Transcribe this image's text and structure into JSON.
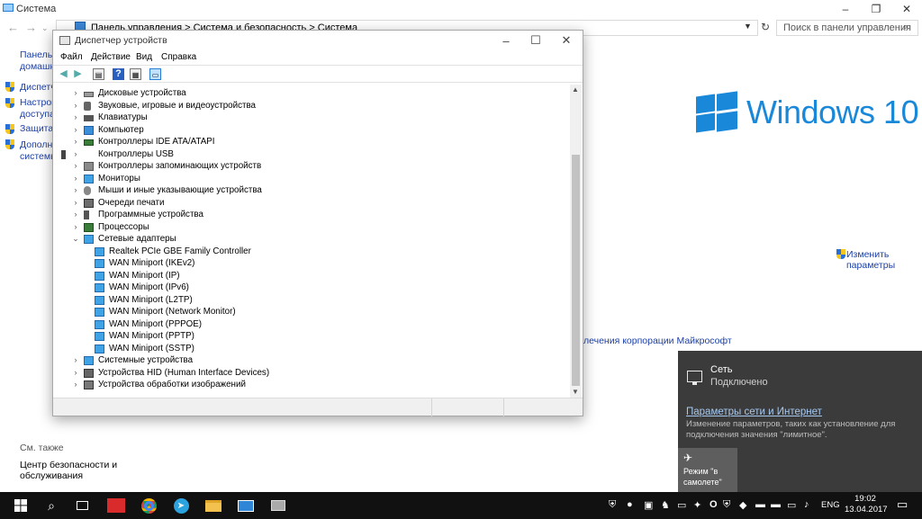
{
  "system_window": {
    "title": "Система",
    "address": "Панель управления  >  Система и безопасность  >  Система",
    "search_placeholder": "Поиск в панели управления",
    "left_nav": [
      {
        "label": "Панель у",
        "label2": "домашн"
      },
      {
        "label": "Диспетч"
      },
      {
        "label": "Настрой",
        "label2": "доступа"
      },
      {
        "label": "Защита с"
      },
      {
        "label": "Дополни",
        "label2": "системы"
      }
    ],
    "windows_brand": "Windows 10",
    "change_params_line1": "Изменить",
    "change_params_line2": "параметры",
    "ms_link": "лечения корпорации Майкрософт",
    "see_also": "См. также",
    "security_center_line1": "Центр безопасности и",
    "security_center_line2": "обслуживания"
  },
  "device_manager": {
    "title": "Диспетчер устройств",
    "menu": [
      "Файл",
      "Действие",
      "Вид",
      "Справка"
    ],
    "tree": [
      {
        "label": "Дисковые устройства",
        "icon": "disk-icon",
        "expanded": false
      },
      {
        "label": "Звуковые, игровые и видеоустройства",
        "icon": "sound-icon",
        "expanded": false
      },
      {
        "label": "Клавиатуры",
        "icon": "keyboard-icon",
        "expanded": false
      },
      {
        "label": "Компьютер",
        "icon": "computer-icon",
        "expanded": false
      },
      {
        "label": "Контроллеры IDE ATA/ATAPI",
        "icon": "ide-controller-icon",
        "expanded": false
      },
      {
        "label": "Контроллеры USB",
        "icon": "usb-icon",
        "expanded": false
      },
      {
        "label": "Контроллеры запоминающих устройств",
        "icon": "storage-controller-icon",
        "expanded": false
      },
      {
        "label": "Мониторы",
        "icon": "monitor-icon",
        "expanded": false
      },
      {
        "label": "Мыши и иные указывающие устройства",
        "icon": "mouse-icon",
        "expanded": false
      },
      {
        "label": "Очереди печати",
        "icon": "printer-icon",
        "expanded": false
      },
      {
        "label": "Программные устройства",
        "icon": "software-device-icon",
        "expanded": false
      },
      {
        "label": "Процессоры",
        "icon": "processor-icon",
        "expanded": false
      },
      {
        "label": "Сетевые адаптеры",
        "icon": "network-adapter-icon",
        "expanded": true
      },
      {
        "label": "Realtek PCIe GBE Family Controller",
        "icon": "network-adapter-icon",
        "child": true
      },
      {
        "label": "WAN Miniport (IKEv2)",
        "icon": "network-adapter-icon",
        "child": true
      },
      {
        "label": "WAN Miniport (IP)",
        "icon": "network-adapter-icon",
        "child": true
      },
      {
        "label": "WAN Miniport (IPv6)",
        "icon": "network-adapter-icon",
        "child": true
      },
      {
        "label": "WAN Miniport (L2TP)",
        "icon": "network-adapter-icon",
        "child": true
      },
      {
        "label": "WAN Miniport (Network Monitor)",
        "icon": "network-adapter-icon",
        "child": true
      },
      {
        "label": "WAN Miniport (PPPOE)",
        "icon": "network-adapter-icon",
        "child": true
      },
      {
        "label": "WAN Miniport (PPTP)",
        "icon": "network-adapter-icon",
        "child": true
      },
      {
        "label": "WAN Miniport (SSTP)",
        "icon": "network-adapter-icon",
        "child": true
      },
      {
        "label": "Системные устройства",
        "icon": "system-device-icon",
        "expanded": false
      },
      {
        "label": "Устройства HID (Human Interface Devices)",
        "icon": "hid-icon",
        "expanded": false
      },
      {
        "label": "Устройства обработки изображений",
        "icon": "imaging-icon",
        "expanded": false
      }
    ]
  },
  "network_flyout": {
    "network_label": "Сеть",
    "status": "Подключено",
    "settings_link": "Параметры сети и Интернет",
    "description": "Изменение параметров, таких как установление для подключения значения \"лимитное\".",
    "airplane_tile": "Режим \"в самолете\""
  },
  "taskbar": {
    "language": "ENG",
    "time": "19:02",
    "date": "13.04.2017"
  },
  "colors": {
    "accent": "#1a88d9",
    "flyout_bg": "#3b3b3b",
    "taskbar_bg": "#111111"
  }
}
